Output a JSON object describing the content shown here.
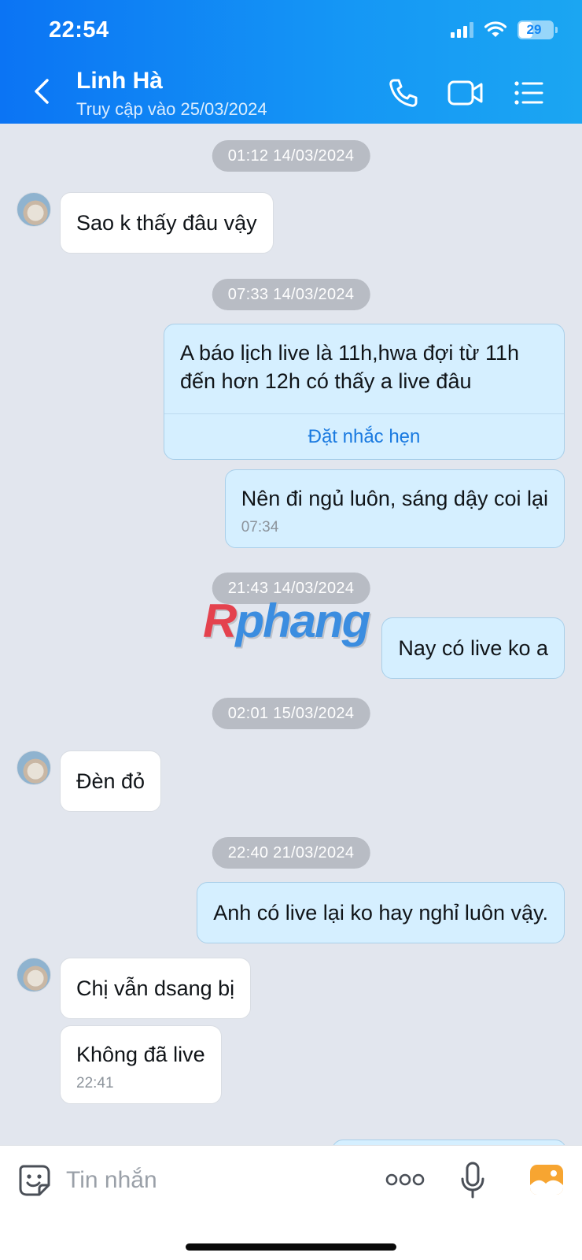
{
  "status_bar": {
    "time": "22:54",
    "battery": "29"
  },
  "header": {
    "name": "Linh Hà",
    "status": "Truy cập vào 25/03/2024"
  },
  "messages": [
    {
      "type": "timestamp",
      "text": "01:12 14/03/2024"
    },
    {
      "type": "incoming",
      "text": "Sao k thấy đâu vậy"
    },
    {
      "type": "timestamp",
      "text": "07:33 14/03/2024"
    },
    {
      "type": "outgoing",
      "lines": [
        "A báo lịch live là 11h,hwa đợi từ 11h",
        "đến hơn 12h có thấy a live đâu"
      ],
      "action": "Đặt nhắc hẹn"
    },
    {
      "type": "outgoing",
      "text": "Nên đi ngủ luôn, sáng dậy coi lại",
      "time": "07:34"
    },
    {
      "type": "timestamp",
      "text": "21:43 14/03/2024"
    },
    {
      "type": "outgoing",
      "text": "Nay có live ko a"
    },
    {
      "type": "timestamp",
      "text": "02:01 15/03/2024"
    },
    {
      "type": "incoming",
      "text": "Đèn đỏ"
    },
    {
      "type": "timestamp",
      "text": "22:40 21/03/2024"
    },
    {
      "type": "outgoing",
      "text": "Anh có live lại ko hay nghỉ luôn vậy."
    },
    {
      "type": "incoming",
      "text": "Chị vẫn dsang bị"
    },
    {
      "type": "incoming",
      "text": "Không đã live",
      "time": "22:41"
    }
  ],
  "watermark": {
    "part1": "R",
    "part2": "phang"
  },
  "input": {
    "placeholder": "Tin nhắn"
  },
  "colors": {
    "header": "#0b74f4",
    "outgoing_bubble": "#d5efff",
    "incoming_bubble": "#ffffff",
    "background": "#e2e6ee",
    "link": "#1a7ae0"
  }
}
